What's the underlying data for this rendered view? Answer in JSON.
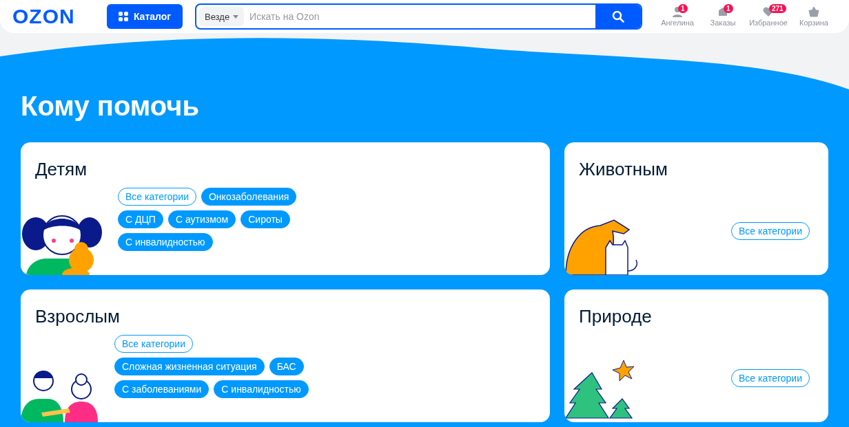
{
  "header": {
    "logo": "OZON",
    "catalog_button": "Каталог",
    "search": {
      "scope": "Везде",
      "placeholder": "Искать на Ozon"
    },
    "nav": [
      {
        "kind": "user",
        "label": "Ангелина",
        "badge": "1"
      },
      {
        "kind": "orders",
        "label": "Заказы",
        "badge": "1"
      },
      {
        "kind": "favorites",
        "label": "Избранное",
        "badge": "271"
      },
      {
        "kind": "cart",
        "label": "Корзина"
      }
    ]
  },
  "title": "Кому помочь",
  "cards": [
    {
      "kind": "children",
      "title": "Детям",
      "chips": [
        {
          "label": "Все категории",
          "kind": "outline"
        },
        {
          "label": "Онкозаболевания",
          "kind": "filled"
        },
        {
          "label": "С ДЦП",
          "kind": "filled"
        },
        {
          "label": "С аутизмом",
          "kind": "filled"
        },
        {
          "label": "Сироты",
          "kind": "filled"
        },
        {
          "label": "С инвалидностью",
          "kind": "filled"
        }
      ]
    },
    {
      "kind": "animals",
      "title": "Животным",
      "chips": [
        {
          "label": "Все категории",
          "kind": "outline"
        }
      ]
    },
    {
      "kind": "adults",
      "title": "Взрослым",
      "chips": [
        {
          "label": "Все категории",
          "kind": "outline"
        },
        {
          "label": "Сложная жизненная ситуация",
          "kind": "filled"
        },
        {
          "label": "БАС",
          "kind": "filled"
        },
        {
          "label": "С заболеваниями",
          "kind": "filled"
        },
        {
          "label": "С инвалидностью",
          "kind": "filled"
        }
      ]
    },
    {
      "kind": "nature",
      "title": "Природе",
      "chips": [
        {
          "label": "Все категории",
          "kind": "outline"
        }
      ]
    }
  ]
}
